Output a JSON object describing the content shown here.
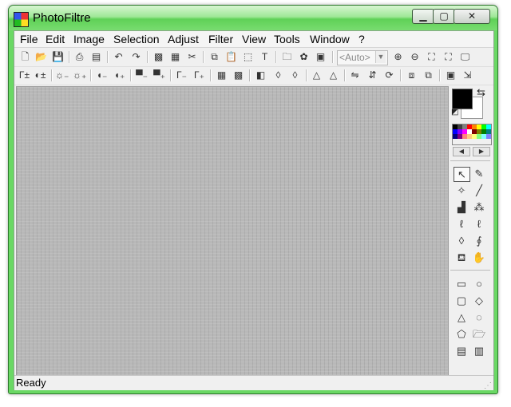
{
  "window": {
    "title": "PhotoFiltre",
    "minimize_glyph": "▁",
    "maximize_glyph": "▢",
    "close_glyph": "✕"
  },
  "menu": [
    {
      "label": "File"
    },
    {
      "label": "Edit"
    },
    {
      "label": "Image"
    },
    {
      "label": "Selection"
    },
    {
      "label": "Adjust"
    },
    {
      "label": "Filter"
    },
    {
      "label": "View"
    },
    {
      "label": "Tools"
    },
    {
      "label": "Window"
    },
    {
      "label": "?"
    }
  ],
  "toolbar1": {
    "buttons": [
      {
        "name": "new-document-icon",
        "glyph": "🗋"
      },
      {
        "name": "open-folder-icon",
        "glyph": "📂"
      },
      {
        "name": "save-icon",
        "glyph": "💾"
      },
      {
        "name": "print-icon",
        "glyph": "⎙"
      },
      {
        "name": "scan-icon",
        "glyph": "▤"
      },
      {
        "name": "undo-icon",
        "glyph": "↶"
      },
      {
        "name": "redo-icon",
        "glyph": "↷"
      },
      {
        "name": "fill-icon",
        "glyph": "▩"
      },
      {
        "name": "pattern-icon",
        "glyph": "▦"
      },
      {
        "name": "cutout-icon",
        "glyph": "✂"
      },
      {
        "name": "copy-icon",
        "glyph": "⧉"
      },
      {
        "name": "paste-icon",
        "glyph": "📋"
      },
      {
        "name": "crop-icon",
        "glyph": "⬚"
      },
      {
        "name": "text-icon",
        "glyph": "T"
      },
      {
        "name": "explorer-icon",
        "glyph": "🗀"
      },
      {
        "name": "plugin-icon",
        "glyph": "✿"
      },
      {
        "name": "screen-capture-icon",
        "glyph": "▣"
      }
    ],
    "zoom_value": "<Auto>",
    "zoom_buttons": [
      {
        "name": "zoom-in-icon",
        "glyph": "⊕"
      },
      {
        "name": "zoom-out-icon",
        "glyph": "⊖"
      },
      {
        "name": "actual-size-icon",
        "glyph": "⛶"
      },
      {
        "name": "fit-window-icon",
        "glyph": "⛶"
      },
      {
        "name": "full-screen-icon",
        "glyph": "🖵"
      }
    ]
  },
  "toolbar2": {
    "buttons": [
      {
        "name": "auto-levels-icon",
        "glyph": "Γ±"
      },
      {
        "name": "auto-contrast-icon",
        "glyph": "◐±"
      },
      {
        "name": "brightness-minus-icon",
        "glyph": "☼₋"
      },
      {
        "name": "brightness-plus-icon",
        "glyph": "☼₊"
      },
      {
        "name": "contrast-minus-icon",
        "glyph": "◖₋"
      },
      {
        "name": "contrast-plus-icon",
        "glyph": "◖₊"
      },
      {
        "name": "saturation-minus-icon",
        "glyph": "▀₋"
      },
      {
        "name": "saturation-plus-icon",
        "glyph": "▀₊"
      },
      {
        "name": "gamma-minus-icon",
        "glyph": "Γ₋"
      },
      {
        "name": "gamma-plus-icon",
        "glyph": "Γ₊"
      },
      {
        "name": "grayscale-icon",
        "glyph": "▦"
      },
      {
        "name": "posterize-icon",
        "glyph": "▩"
      },
      {
        "name": "dither-icon",
        "glyph": "◧"
      },
      {
        "name": "blur-icon",
        "glyph": "◊"
      },
      {
        "name": "sharpen-icon",
        "glyph": "◊"
      },
      {
        "name": "soften-icon",
        "glyph": "△"
      },
      {
        "name": "emboss-icon",
        "glyph": "△"
      },
      {
        "name": "flip-horizontal-icon",
        "glyph": "⇋"
      },
      {
        "name": "flip-vertical-icon",
        "glyph": "⇵"
      },
      {
        "name": "rotate-icon",
        "glyph": "⟳"
      },
      {
        "name": "image-size-icon",
        "glyph": "⧈"
      },
      {
        "name": "canvas-size-icon",
        "glyph": "⧉"
      },
      {
        "name": "transparent-color-icon",
        "glyph": "▣"
      },
      {
        "name": "export-icon",
        "glyph": "⇲"
      }
    ]
  },
  "colors": {
    "foreground": "#000000",
    "background": "#ffffff",
    "palette": [
      "#000000",
      "#404040",
      "#7f7f7f",
      "#ff0000",
      "#ff7f00",
      "#ffff00",
      "#00ff00",
      "#00ffff",
      "#0000ff",
      "#7f00ff",
      "#ff00ff",
      "#ffffff",
      "#800000",
      "#808000",
      "#008000",
      "#008080",
      "#000080",
      "#800080",
      "#ff8080",
      "#ffcc80",
      "#ffff80",
      "#80ff80",
      "#80ffff",
      "#8080ff"
    ],
    "swap_glyph": "⇆",
    "reset_glyph": "◩",
    "palette_prev_glyph": "◀",
    "palette_next_glyph": "▶"
  },
  "tools": [
    {
      "name": "selection-arrow-icon",
      "glyph": "↖",
      "selected": true
    },
    {
      "name": "color-picker-icon",
      "glyph": "✎",
      "selected": false
    },
    {
      "name": "magic-wand-icon",
      "glyph": "✧",
      "selected": false
    },
    {
      "name": "line-icon",
      "glyph": "╱",
      "selected": false
    },
    {
      "name": "fill-bucket-icon",
      "glyph": "▟",
      "selected": false
    },
    {
      "name": "spray-icon",
      "glyph": "⁂",
      "selected": false
    },
    {
      "name": "brush-icon",
      "glyph": "ℓ",
      "selected": false
    },
    {
      "name": "advanced-brush-icon",
      "glyph": "ℓ",
      "selected": false
    },
    {
      "name": "blur-drop-icon",
      "glyph": "◊",
      "selected": false
    },
    {
      "name": "finger-icon",
      "glyph": "∮",
      "selected": false
    },
    {
      "name": "clone-stamp-icon",
      "glyph": "⛾",
      "selected": false
    },
    {
      "name": "hand-icon",
      "glyph": "✋",
      "selected": false
    }
  ],
  "shapes": [
    {
      "name": "rectangle-shape-icon",
      "glyph": "▭"
    },
    {
      "name": "ellipse-shape-icon",
      "glyph": "○"
    },
    {
      "name": "rounded-rect-shape-icon",
      "glyph": "▢"
    },
    {
      "name": "diamond-shape-icon",
      "glyph": "◇"
    },
    {
      "name": "triangle-shape-icon",
      "glyph": "△"
    },
    {
      "name": "lasso-shape-icon",
      "glyph": "◌"
    },
    {
      "name": "polygon-shape-icon",
      "glyph": "⬠"
    },
    {
      "name": "load-shape-icon",
      "glyph": "🗁"
    },
    {
      "name": "shape-options-icon",
      "glyph": "▤"
    },
    {
      "name": "shape-properties-icon",
      "glyph": "▥"
    }
  ],
  "status": {
    "text": "Ready"
  }
}
